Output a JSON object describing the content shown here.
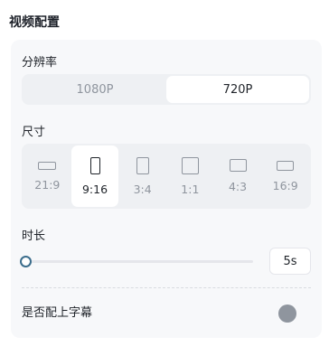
{
  "title": "视频配置",
  "resolution": {
    "label": "分辨率",
    "options": [
      "1080P",
      "720P"
    ],
    "selected": "720P"
  },
  "size": {
    "label": "尺寸",
    "options": [
      "21:9",
      "9:16",
      "3:4",
      "1:1",
      "4:3",
      "16:9"
    ],
    "selected": "9:16"
  },
  "duration": {
    "label": "时长",
    "value": "5s",
    "slider_fraction": 0
  },
  "subtitles": {
    "label": "是否配上字幕",
    "enabled": false
  },
  "colors": {
    "accent": "#3b6d8c",
    "toggle_off": "#8f959e"
  }
}
